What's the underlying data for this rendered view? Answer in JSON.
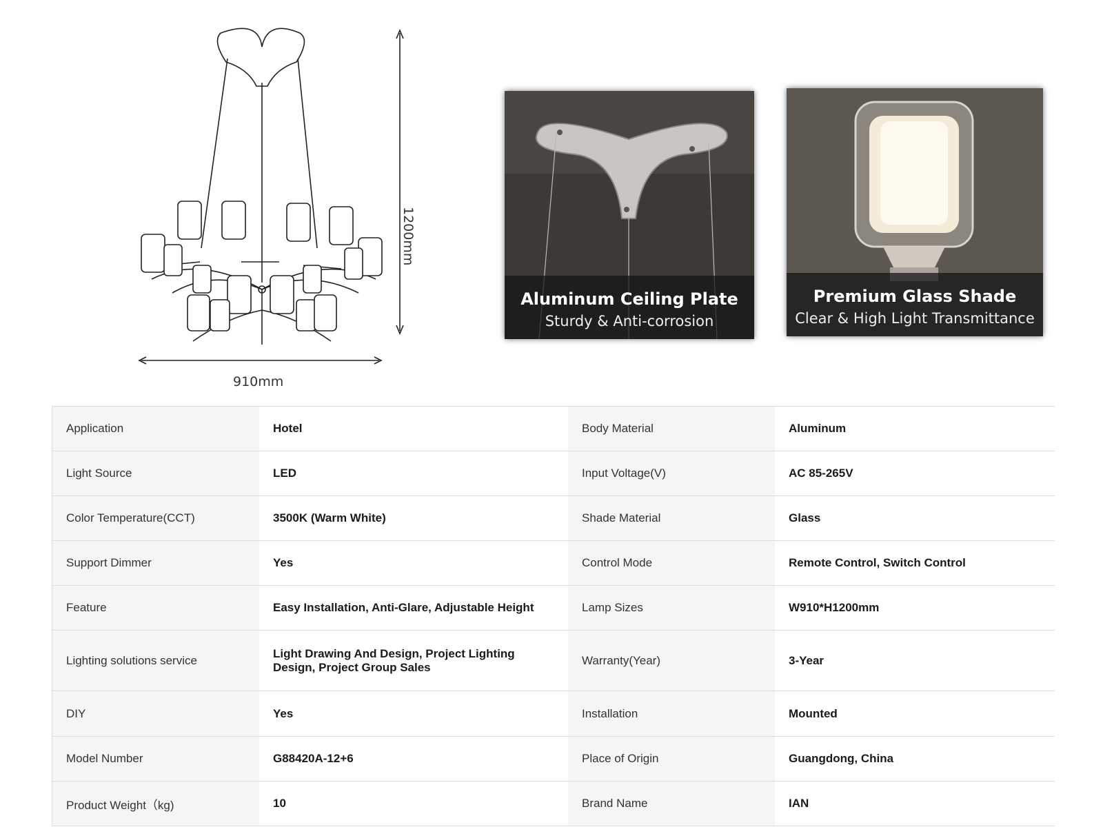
{
  "drawing": {
    "width_label": "910mm",
    "height_label": "1200mm"
  },
  "photos": [
    {
      "title": "Aluminum Ceiling Plate",
      "subtitle": "Sturdy & Anti-corrosion"
    },
    {
      "title": "Premium Glass Shade",
      "subtitle": "Clear & High Light Transmittance"
    }
  ],
  "specs": [
    {
      "k1": "Application",
      "v1": "Hotel",
      "k2": "Body Material",
      "v2": "Aluminum"
    },
    {
      "k1": "Light Source",
      "v1": "LED",
      "k2": "Input Voltage(V)",
      "v2": "AC 85-265V"
    },
    {
      "k1": "Color Temperature(CCT)",
      "v1": "3500K (Warm White)",
      "k2": "Shade Material",
      "v2": "Glass"
    },
    {
      "k1": "Support Dimmer",
      "v1": "Yes",
      "k2": "Control Mode",
      "v2": "Remote Control, Switch Control"
    },
    {
      "k1": "Feature",
      "v1": "Easy Installation, Anti-Glare, Adjustable Height",
      "k2": "Lamp Sizes",
      "v2": "W910*H1200mm"
    },
    {
      "k1": "Lighting solutions service",
      "v1": "Light Drawing And Design, Project Lighting Design, Project Group Sales",
      "k2": "Warranty(Year)",
      "v2": "3-Year"
    },
    {
      "k1": "DIY",
      "v1": "Yes",
      "k2": "Installation",
      "v2": "Mounted"
    },
    {
      "k1": "Model Number",
      "v1": "G88420A-12+6",
      "k2": "Place of Origin",
      "v2": "Guangdong, China"
    },
    {
      "k1": "Product Weight（kg)",
      "v1": "10",
      "k2": "Brand Name",
      "v2": "IAN"
    }
  ]
}
